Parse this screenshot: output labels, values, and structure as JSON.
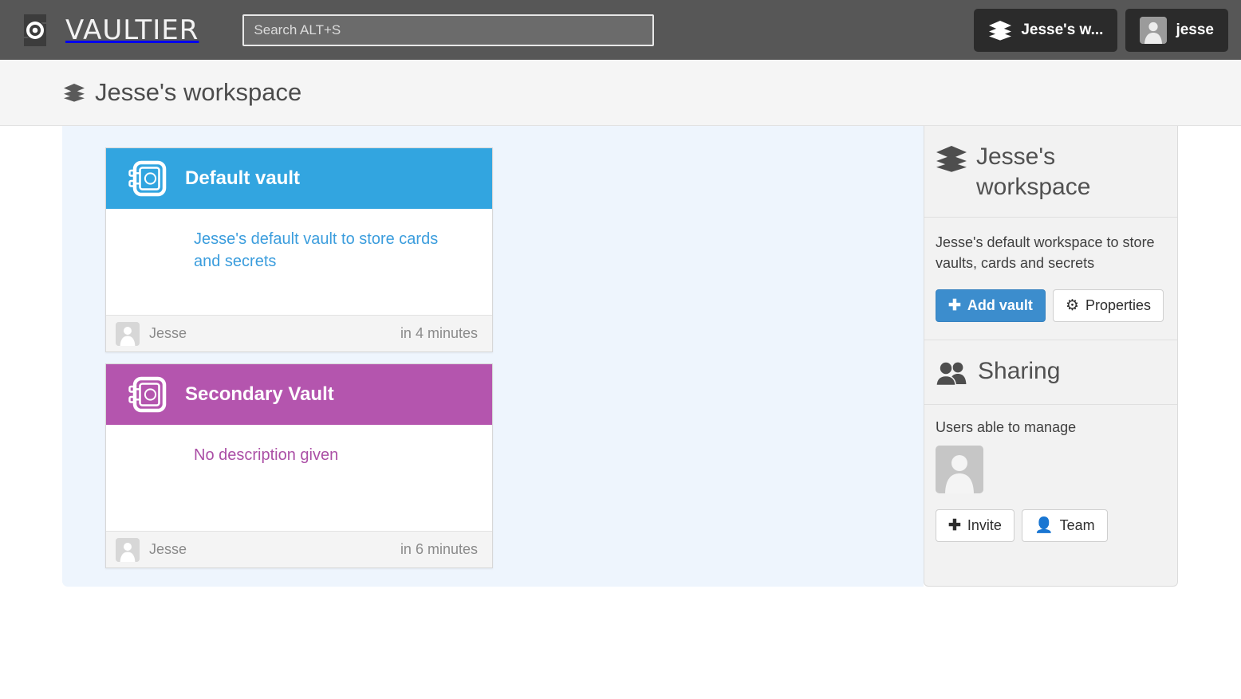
{
  "app": {
    "brand_name": "VAULTIER",
    "logo_icon": "vaultier-target-logo-icon"
  },
  "navbar": {
    "search": {
      "placeholder": "Search ALT+S",
      "value": "",
      "icon": "search-icon"
    },
    "workspace_button": {
      "label": "Jesse's w...",
      "icon": "layers-icon"
    },
    "user_button": {
      "label": "jesse",
      "icon": "user-avatar-icon"
    }
  },
  "breadcrumb": {
    "icon": "layers-icon",
    "label": "Jesse's workspace"
  },
  "vaults": [
    {
      "title": "Default vault",
      "description": "Jesse's default vault to store cards and secrets",
      "author": "Jesse",
      "time": "in 4 minutes",
      "color": "#32a5e0",
      "text_color": "#3b9ddd",
      "icon": "vault-safe-icon",
      "avatar_icon": "user-avatar-icon"
    },
    {
      "title": "Secondary Vault",
      "description": "No description given",
      "author": "Jesse",
      "time": "in 6 minutes",
      "color": "#b455ae",
      "text_color": "#ab4fa6",
      "icon": "vault-safe-icon",
      "avatar_icon": "user-avatar-icon"
    }
  ],
  "sidebar": {
    "workspace": {
      "icon": "layers-icon",
      "title": "Jesse's workspace",
      "description": "Jesse's default workspace to store vaults, cards and secrets",
      "add_vault_label": "Add vault",
      "add_vault_glyph": "plus-icon",
      "properties_label": "Properties",
      "properties_glyph": "gear-icon"
    },
    "sharing": {
      "icon": "people-icon",
      "title": "Sharing",
      "users_label": "Users able to manage",
      "member_avatar_icon": "user-avatar-icon",
      "invite_label": "Invite",
      "invite_glyph": "plus-icon",
      "team_label": "Team",
      "team_glyph": "user-icon"
    }
  },
  "theme": {
    "navbar_bg": "#575757",
    "nav_button_bg": "#2b2b2b",
    "crumbbar_bg": "#f5f5f5",
    "panel_bg": "#eef5fd",
    "sidebar_bg": "#f2f2f2",
    "primary_blue": "#3c8dcd",
    "vault_blue": "#32a5e0",
    "vault_purple": "#b455ae"
  }
}
